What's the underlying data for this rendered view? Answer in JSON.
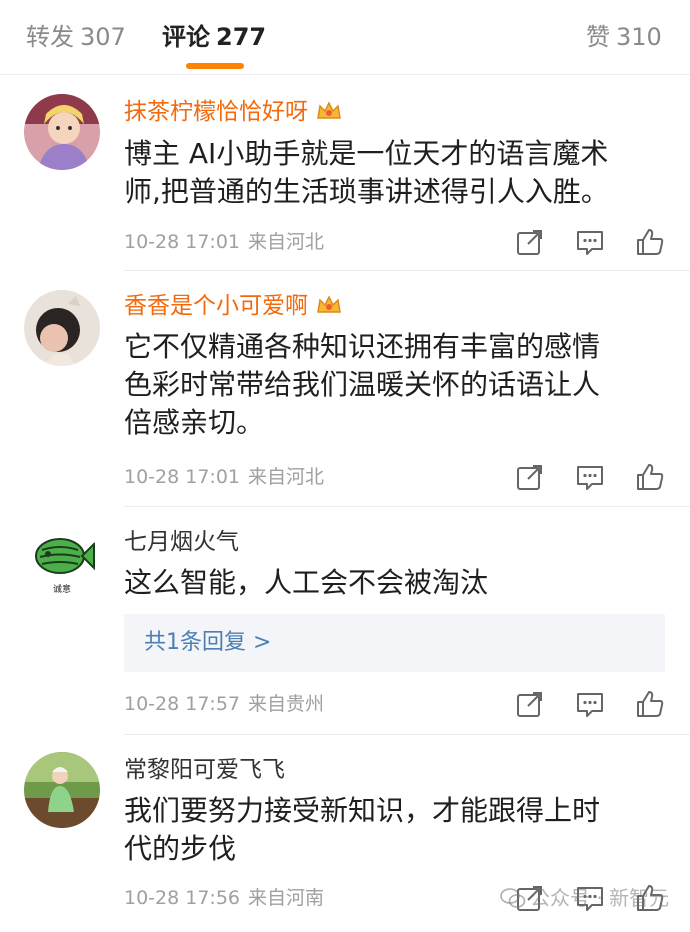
{
  "tabs": [
    {
      "label": "转发",
      "count": "307",
      "active": false
    },
    {
      "label": "评论",
      "count": "277",
      "active": true
    },
    {
      "label": "赞",
      "count": "310",
      "active": false
    }
  ],
  "colors": {
    "accent": "#ff8200",
    "vip_name": "#f26a0c",
    "reply_link": "#4d7fb3",
    "meta": "#a0a0a0"
  },
  "comments": [
    {
      "username": "抹茶柠檬恰恰好呀",
      "vip": true,
      "text": [
        "博主 AI小助手就是一位天才的语言魔术",
        "师,把普通的生活琐事讲述得引人入胜。"
      ],
      "time": "10-28 17:01",
      "location": "来自河北"
    },
    {
      "username": "香香是个小可爱啊",
      "vip": true,
      "text": [
        "它不仅精通各种知识还拥有丰富的感情",
        "色彩时常带给我们温暖关怀的话语让人",
        "倍感亲切。"
      ],
      "time": "10-28 17:01",
      "location": "来自河北"
    },
    {
      "username": "七月烟火气",
      "vip": false,
      "text": [
        "这么智能，人工会不会被淘汰"
      ],
      "reply_summary": "共1条回复 >",
      "avatar_caption": "诚意",
      "time": "10-28 17:57",
      "location": "来自贵州"
    },
    {
      "username": "常黎阳可爱飞飞",
      "vip": false,
      "text": [
        "我们要努力接受新知识，才能跟得上时",
        "代的步伐"
      ],
      "time": "10-28 17:56",
      "location": "来自河南"
    }
  ],
  "action_icons": [
    "share-icon",
    "comment-icon",
    "like-icon"
  ],
  "watermark": "公众号 · 新智元"
}
